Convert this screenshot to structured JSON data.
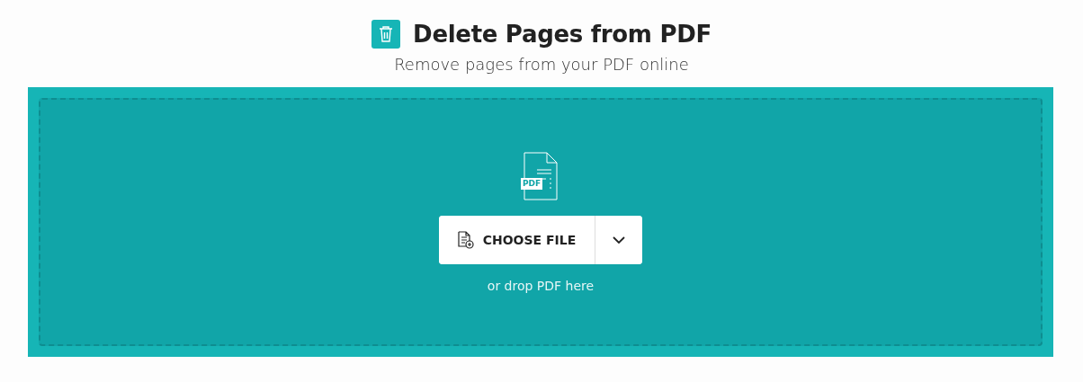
{
  "header": {
    "title": "Delete Pages from PDF",
    "subtitle": "Remove pages from your PDF online"
  },
  "dropzone": {
    "file_badge": "PDF",
    "button": "CHOOSE FILE",
    "hint": "or drop PDF here"
  }
}
